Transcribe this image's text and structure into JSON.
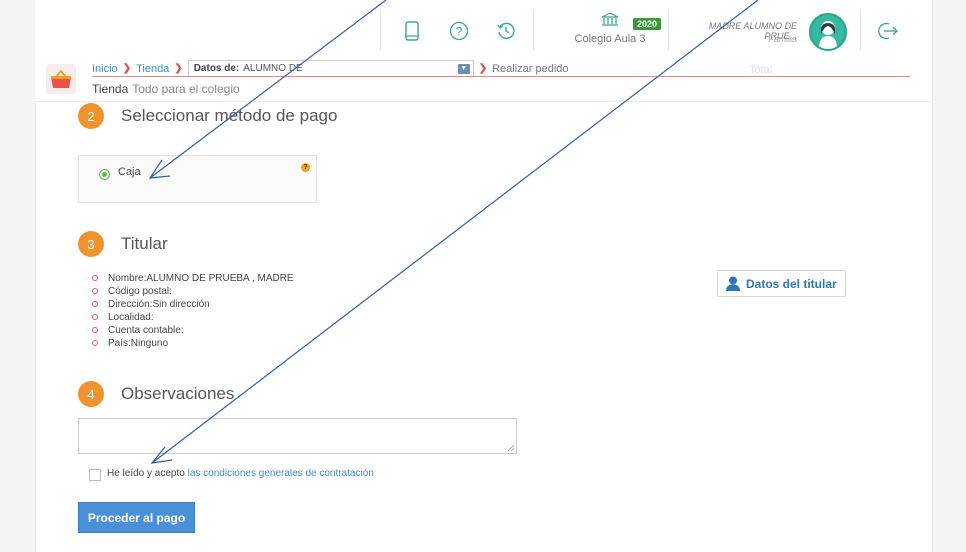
{
  "header": {
    "school_name": "Colegio Aula 3",
    "year_badge": "2020",
    "user_name": "MADRE ALUMNO DE PRUE...",
    "user_role": "Familia",
    "icons": [
      "tablet-icon",
      "help-icon",
      "history-icon",
      "school-icon",
      "logout-icon"
    ]
  },
  "breadcrumb": {
    "home": "Inicio",
    "shop": "Tienda",
    "data_label": "Datos de:",
    "data_value": "ALUMNO DE",
    "current": "Realizar pedido",
    "total_ghost": "Total"
  },
  "page": {
    "title": "Tienda",
    "subtitle": "Todo para el colegio"
  },
  "step2": {
    "number": "2",
    "title": "Seleccionar método de pago",
    "option": "Caja",
    "help": "?"
  },
  "step3": {
    "number": "3",
    "title": "Titular",
    "items": [
      "Nombre:ALUMNO DE PRUEBA , MADRE",
      "Código postal:",
      "Dirección:Sin dirección",
      "Localidad:",
      "Cuenta contable:",
      "País:Ninguno"
    ],
    "button": "Datos del titular"
  },
  "step4": {
    "number": "4",
    "title": "Observaciones",
    "textarea_value": "",
    "accept_text": "He leído y acepto",
    "accept_link": "las condiciones generales de contratación",
    "accept_checked": false
  },
  "actions": {
    "pay_button": "Proceder al pago"
  },
  "colors": {
    "accent": "#4a90d9",
    "step": "#f0922d",
    "radio": "#5cb85c",
    "breadcrumb_arrow": "#d9534f",
    "annotation_arrow": "#2e5ea8"
  }
}
